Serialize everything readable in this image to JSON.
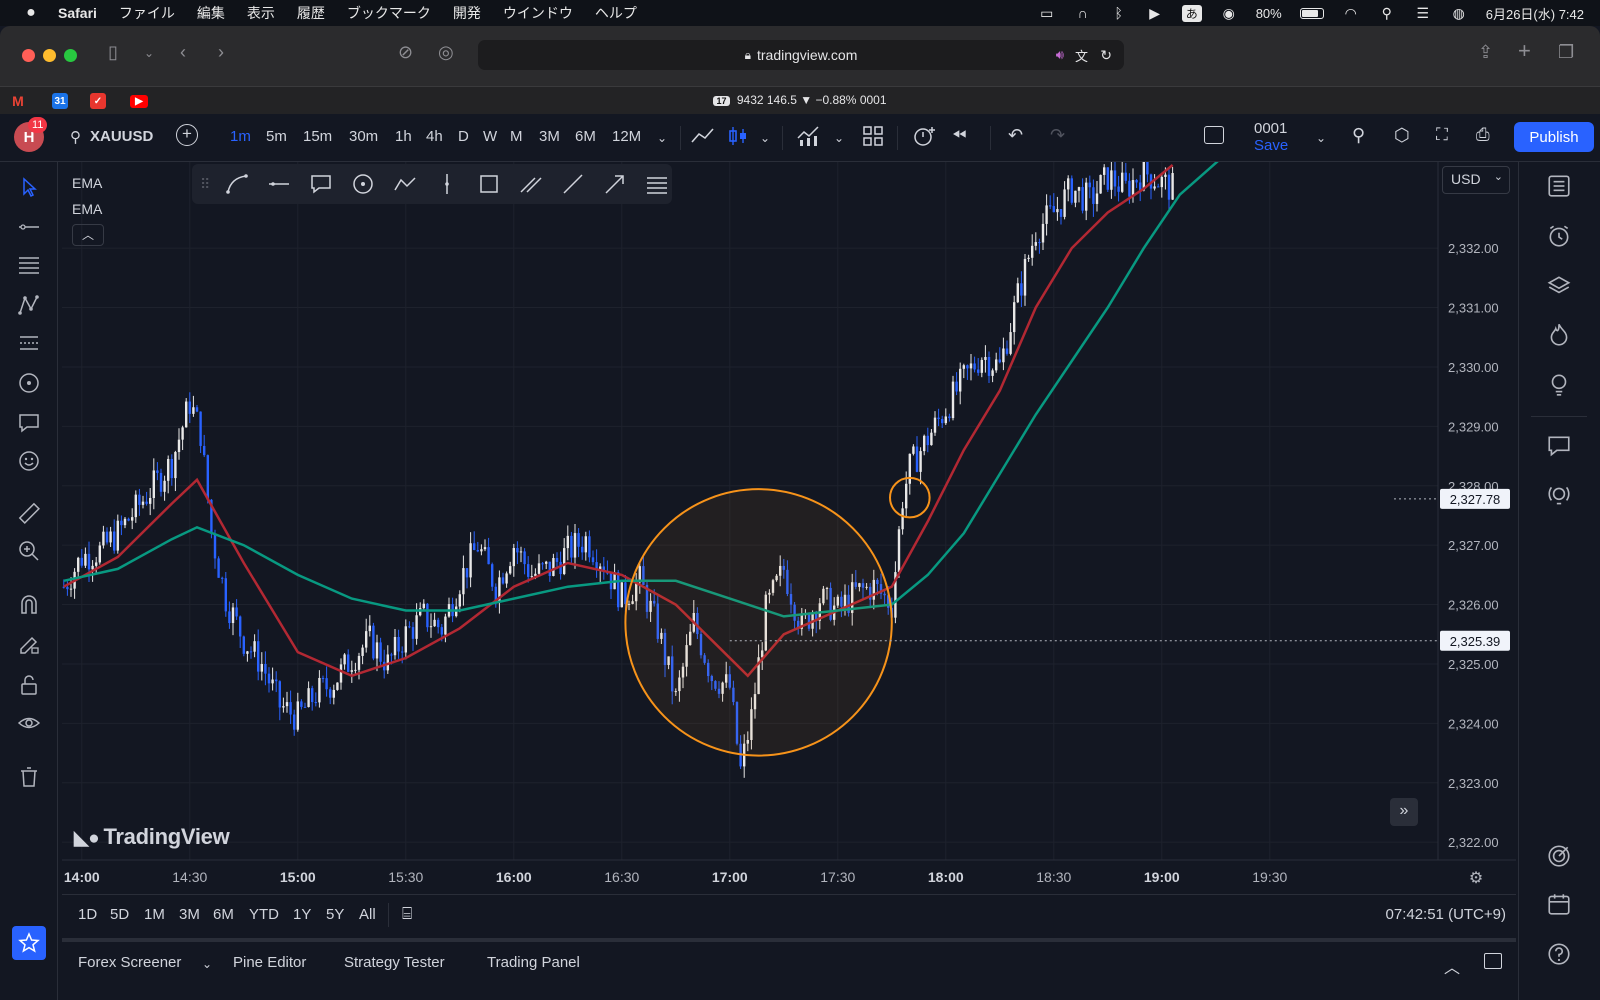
{
  "menubar": {
    "app": "Safari",
    "items": [
      "ファイル",
      "編集",
      "表示",
      "履歴",
      "ブックマーク",
      "開発",
      "ウインドウ",
      "ヘルプ"
    ],
    "input_method": "あ",
    "battery": "80%",
    "datetime": "6月26日(水)  7:42"
  },
  "browser": {
    "url": "tradingview.com",
    "tab_title": "9432 146.5 ▼ −0.88% 0001",
    "tab_badge": "17"
  },
  "toolbar": {
    "avatar_letter": "H",
    "notifications": "11",
    "symbol": "XAUUSD",
    "intervals": [
      "1m",
      "5m",
      "15m",
      "30m",
      "1h",
      "4h",
      "D",
      "W",
      "M",
      "3M",
      "6M",
      "12M"
    ],
    "active_interval": "1m",
    "layout_name": "0001",
    "save_label": "Save",
    "publish_label": "Publish"
  },
  "legend": {
    "indicators": [
      "EMA",
      "EMA"
    ]
  },
  "currency": "USD",
  "watermark": "TradingView",
  "ranges": [
    "1D",
    "5D",
    "1M",
    "3M",
    "6M",
    "YTD",
    "1Y",
    "5Y",
    "All"
  ],
  "clock": "07:42:51 (UTC+9)",
  "panels": [
    "Forex Screener",
    "Pine Editor",
    "Strategy Tester",
    "Trading Panel"
  ],
  "colors": {
    "background": "#131722",
    "up": "#e8e8e8",
    "down": "#2962ff",
    "ema_fast": "#b22833",
    "ema_slow": "#089981",
    "annotation": "#f7931a",
    "accent": "#2962ff"
  },
  "chart_data": {
    "type": "candlestick",
    "symbol": "XAUUSD",
    "interval": "1m",
    "x_ticks": [
      "14:00",
      "14:30",
      "15:00",
      "15:30",
      "16:00",
      "16:30",
      "17:00",
      "17:30",
      "18:00",
      "18:30",
      "19:00",
      "19:30"
    ],
    "x_ticks_bold": [
      "14:00",
      "15:00",
      "16:00",
      "17:00",
      "18:00",
      "19:00"
    ],
    "y_ticks": [
      "2,332.00",
      "2,331.00",
      "2,330.00",
      "2,329.00",
      "2,328.00",
      "2,327.00",
      "2,326.00",
      "2,325.00",
      "2,324.00",
      "2,323.00",
      "2,322.00"
    ],
    "ylim": [
      2321.7,
      2333.45
    ],
    "price_labels": [
      {
        "text": "2,327.78",
        "price": 2327.78
      },
      {
        "text": "2,325.39",
        "price": 2325.39
      }
    ],
    "close_path": [
      [
        "13:55",
        2326.3
      ],
      [
        "14:00",
        2326.8
      ],
      [
        "14:05",
        2326.9
      ],
      [
        "14:10",
        2327.2
      ],
      [
        "14:15",
        2327.6
      ],
      [
        "14:20",
        2328.0
      ],
      [
        "14:25",
        2328.4
      ],
      [
        "14:30",
        2329.4
      ],
      [
        "14:33",
        2328.9
      ],
      [
        "14:36",
        2327.2
      ],
      [
        "14:40",
        2326.1
      ],
      [
        "14:45",
        2325.4
      ],
      [
        "14:50",
        2325.0
      ],
      [
        "14:55",
        2324.3
      ],
      [
        "15:00",
        2324.1
      ],
      [
        "15:05",
        2324.5
      ],
      [
        "15:10",
        2324.7
      ],
      [
        "15:15",
        2325.1
      ],
      [
        "15:20",
        2325.4
      ],
      [
        "15:25",
        2325.0
      ],
      [
        "15:30",
        2325.5
      ],
      [
        "15:35",
        2325.8
      ],
      [
        "15:40",
        2325.6
      ],
      [
        "15:45",
        2326.4
      ],
      [
        "15:50",
        2327.0
      ],
      [
        "15:55",
        2326.3
      ],
      [
        "16:00",
        2327.0
      ],
      [
        "16:05",
        2326.5
      ],
      [
        "16:10",
        2326.6
      ],
      [
        "16:15",
        2326.9
      ],
      [
        "16:20",
        2327.1
      ],
      [
        "16:25",
        2326.7
      ],
      [
        "16:30",
        2326.1
      ],
      [
        "16:35",
        2326.4
      ],
      [
        "16:40",
        2325.6
      ],
      [
        "16:45",
        2324.4
      ],
      [
        "16:50",
        2325.7
      ],
      [
        "16:55",
        2324.8
      ],
      [
        "17:00",
        2324.6
      ],
      [
        "17:03",
        2323.2
      ],
      [
        "17:06",
        2324.1
      ],
      [
        "17:10",
        2325.9
      ],
      [
        "17:15",
        2326.6
      ],
      [
        "17:20",
        2325.6
      ],
      [
        "17:25",
        2326.1
      ],
      [
        "17:30",
        2325.9
      ],
      [
        "17:35",
        2326.2
      ],
      [
        "17:40",
        2326.3
      ],
      [
        "17:45",
        2326.0
      ],
      [
        "17:48",
        2327.8
      ],
      [
        "17:50",
        2328.3
      ],
      [
        "17:55",
        2328.8
      ],
      [
        "18:00",
        2329.3
      ],
      [
        "18:05",
        2329.8
      ],
      [
        "18:10",
        2330.2
      ],
      [
        "18:15",
        2330.0
      ],
      [
        "18:20",
        2331.2
      ],
      [
        "18:25",
        2332.3
      ],
      [
        "18:30",
        2332.6
      ],
      [
        "18:35",
        2333.0
      ],
      [
        "18:40",
        2332.8
      ],
      [
        "18:45",
        2333.2
      ],
      [
        "18:50",
        2333.0
      ],
      [
        "18:55",
        2333.3
      ],
      [
        "19:00",
        2333.1
      ],
      [
        "19:03",
        2333.0
      ]
    ],
    "series": [
      {
        "type": "ema",
        "color": "#b22833",
        "points": [
          [
            "13:55",
            2326.3
          ],
          [
            "14:10",
            2326.8
          ],
          [
            "14:25",
            2327.7
          ],
          [
            "14:32",
            2328.1
          ],
          [
            "14:45",
            2326.7
          ],
          [
            "15:00",
            2325.2
          ],
          [
            "15:15",
            2324.8
          ],
          [
            "15:30",
            2325.1
          ],
          [
            "15:45",
            2325.6
          ],
          [
            "16:00",
            2326.3
          ],
          [
            "16:15",
            2326.7
          ],
          [
            "16:30",
            2326.5
          ],
          [
            "16:45",
            2326.0
          ],
          [
            "16:55",
            2325.4
          ],
          [
            "17:05",
            2324.8
          ],
          [
            "17:15",
            2325.5
          ],
          [
            "17:30",
            2325.9
          ],
          [
            "17:45",
            2326.3
          ],
          [
            "17:55",
            2327.4
          ],
          [
            "18:05",
            2328.6
          ],
          [
            "18:15",
            2329.6
          ],
          [
            "18:25",
            2331.0
          ],
          [
            "18:35",
            2332.0
          ],
          [
            "18:45",
            2332.6
          ],
          [
            "18:55",
            2333.0
          ],
          [
            "19:03",
            2333.4
          ]
        ]
      },
      {
        "type": "ema",
        "color": "#089981",
        "points": [
          [
            "13:55",
            2326.4
          ],
          [
            "14:10",
            2326.6
          ],
          [
            "14:25",
            2327.1
          ],
          [
            "14:32",
            2327.3
          ],
          [
            "14:45",
            2327.0
          ],
          [
            "15:00",
            2326.5
          ],
          [
            "15:15",
            2326.1
          ],
          [
            "15:30",
            2325.9
          ],
          [
            "15:45",
            2325.9
          ],
          [
            "16:00",
            2326.1
          ],
          [
            "16:15",
            2326.3
          ],
          [
            "16:30",
            2326.4
          ],
          [
            "16:45",
            2326.4
          ],
          [
            "17:00",
            2326.1
          ],
          [
            "17:15",
            2325.8
          ],
          [
            "17:30",
            2325.9
          ],
          [
            "17:45",
            2326.0
          ],
          [
            "17:55",
            2326.5
          ],
          [
            "18:05",
            2327.2
          ],
          [
            "18:15",
            2328.2
          ],
          [
            "18:25",
            2329.2
          ],
          [
            "18:35",
            2330.1
          ],
          [
            "18:45",
            2331.0
          ],
          [
            "18:55",
            2332.0
          ],
          [
            "19:05",
            2332.9
          ],
          [
            "19:20",
            2333.7
          ]
        ]
      }
    ],
    "annotations": [
      {
        "type": "circle",
        "center": [
          "17:08",
          2325.7
        ],
        "radius_minutes": 37,
        "color": "#f7931a"
      },
      {
        "type": "circle",
        "center": [
          "17:50",
          2327.8
        ],
        "radius_minutes": 5.5,
        "color": "#f7931a"
      }
    ]
  }
}
